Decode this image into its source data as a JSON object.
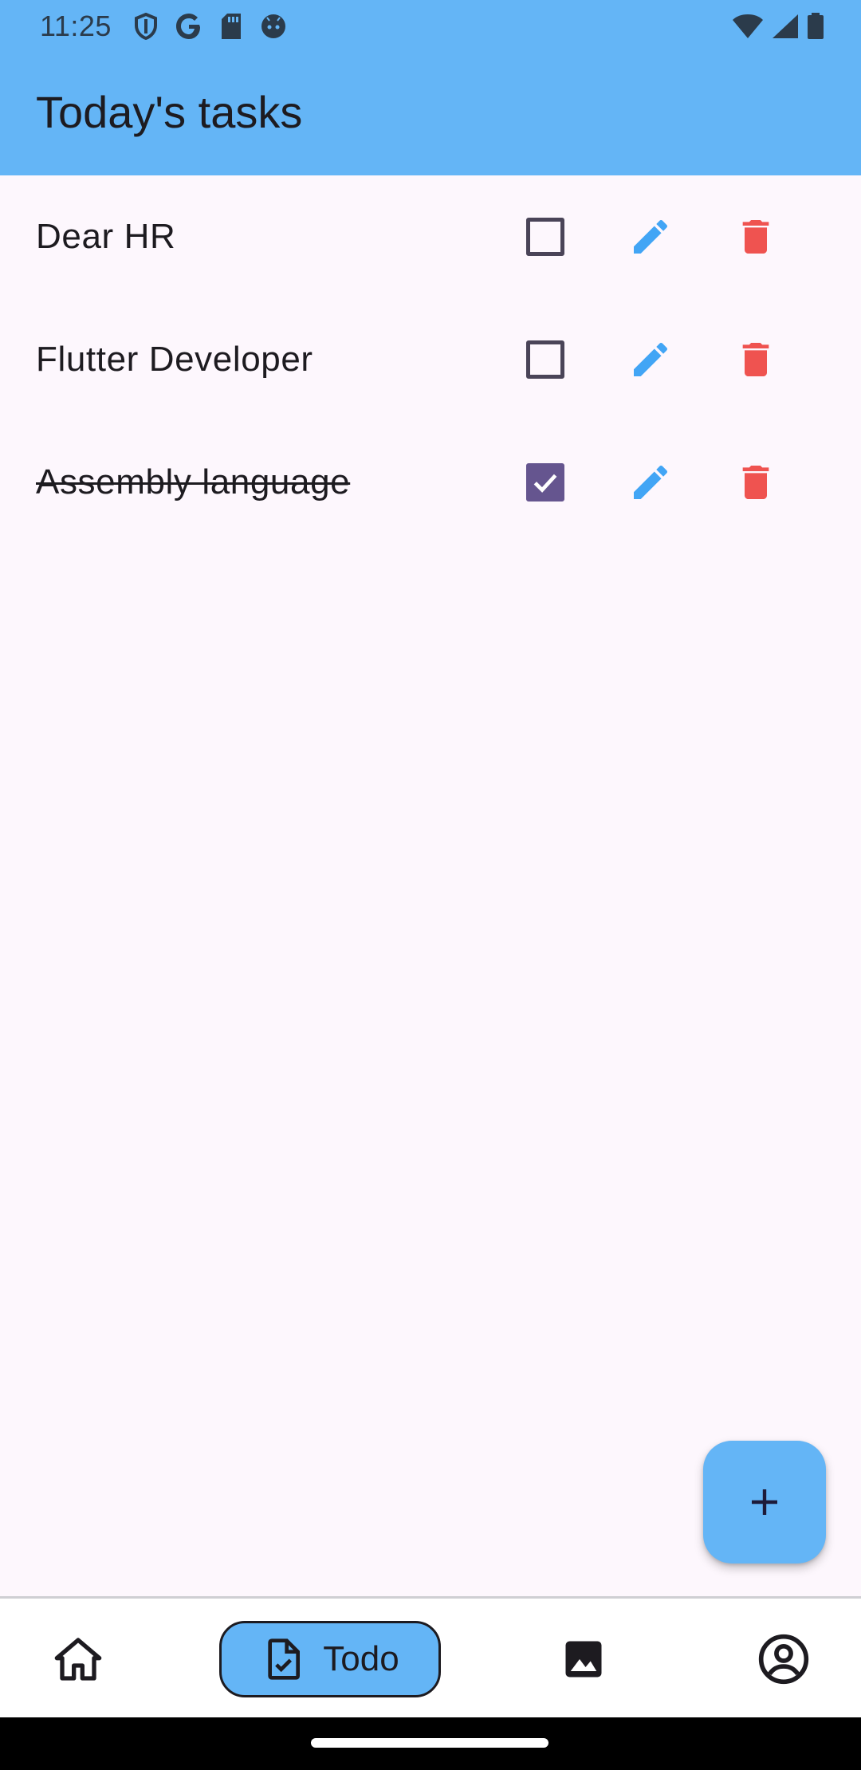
{
  "status_bar": {
    "time": "11:25",
    "left_icons": [
      "shield-icon",
      "google-icon",
      "sd-card-icon",
      "android-icon"
    ],
    "right_icons": [
      "wifi-icon",
      "signal-icon",
      "battery-icon"
    ]
  },
  "app_bar": {
    "title": "Today's tasks",
    "color": "#64b5f6"
  },
  "tasks": [
    {
      "label": "Dear HR",
      "checked": false
    },
    {
      "label": "Flutter Developer",
      "checked": false
    },
    {
      "label": "Assembly language",
      "checked": true
    }
  ],
  "colors": {
    "edit_icon": "#42a5f5",
    "delete_icon": "#ef5350",
    "checkbox_checked": "#65558f",
    "background": "#fdf7fd"
  },
  "fab": {
    "icon": "plus-icon"
  },
  "bottom_nav": {
    "items": [
      {
        "icon": "home-icon",
        "label": ""
      },
      {
        "icon": "todo-document-icon",
        "label": "Todo",
        "selected": true
      },
      {
        "icon": "image-icon",
        "label": ""
      },
      {
        "icon": "account-circle-icon",
        "label": ""
      }
    ]
  }
}
